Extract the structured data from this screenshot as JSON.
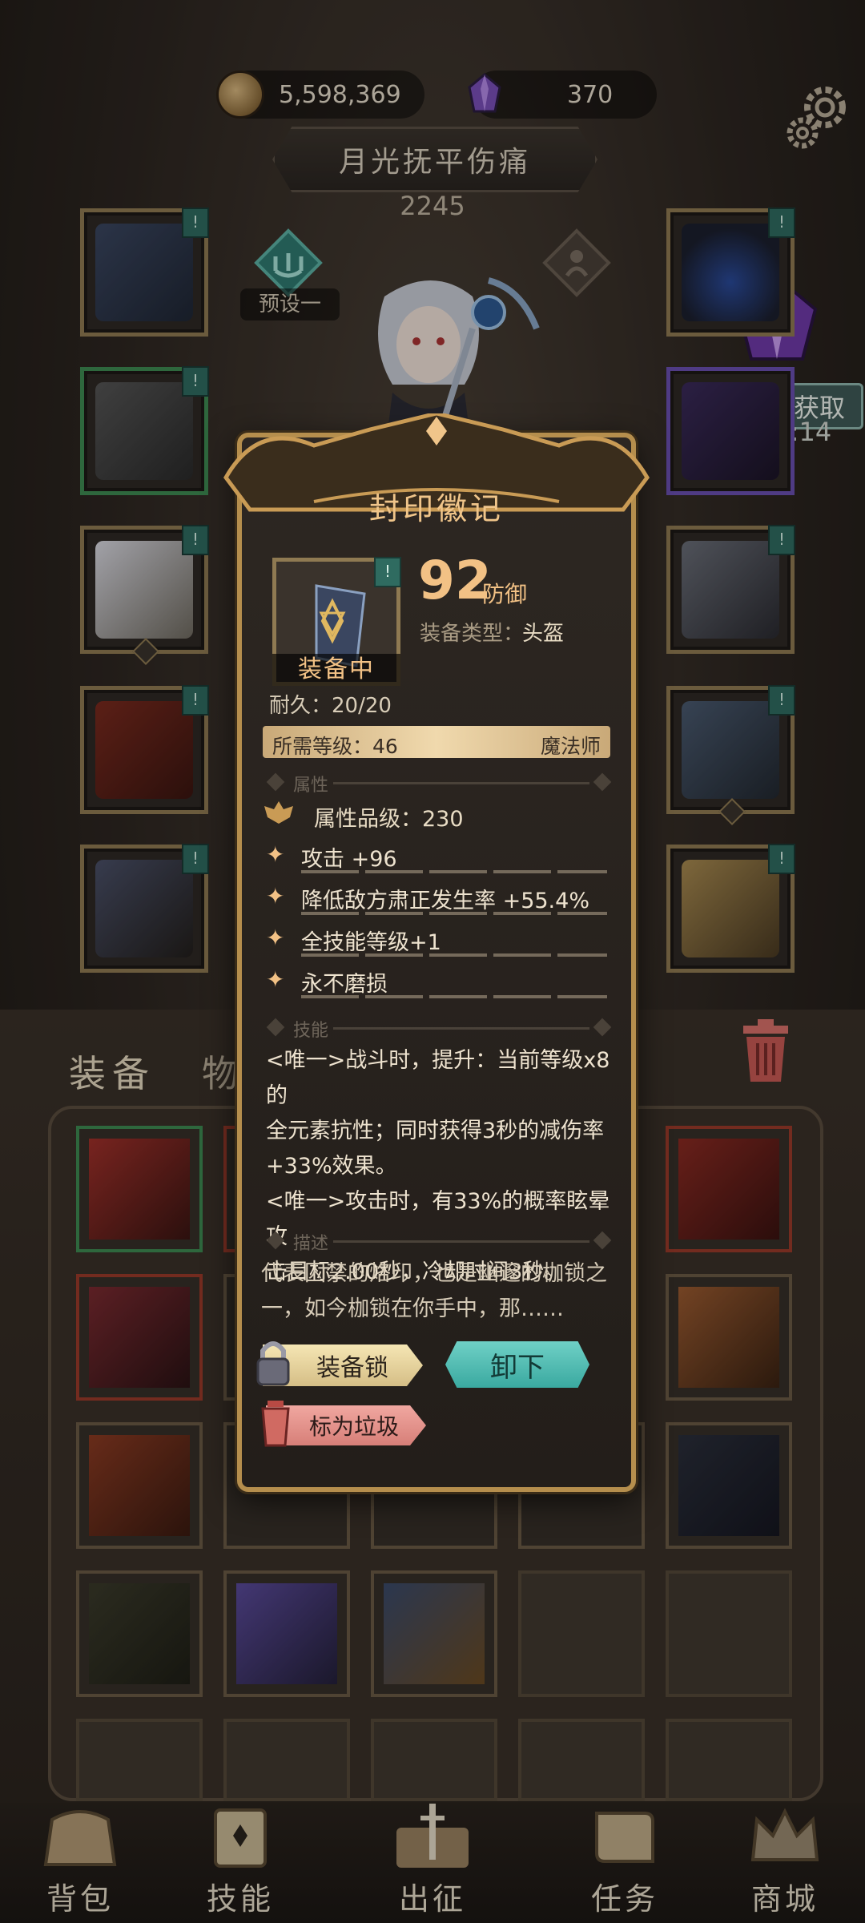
{
  "resources": {
    "gold": {
      "value": "5,598,369",
      "icon": "gold-coin-icon"
    },
    "gems": {
      "value": "370",
      "icon": "purple-crystal-icon"
    }
  },
  "character": {
    "name": "月光抚平伤痛",
    "power": "2245",
    "preset_label": "预设一"
  },
  "video_reward": {
    "label": "视频获取",
    "timer": "00:14"
  },
  "tabs": {
    "equipment": "装备",
    "items": "物品"
  },
  "item_popup": {
    "title": "封印徽记",
    "equipped_label": "装备中",
    "stat_value": "92",
    "stat_unit": "防御",
    "type_label": "装备类型：",
    "type_value": "头盔",
    "durability": "耐久：20/20",
    "required_level": "所需等级：46",
    "class": "魔法师",
    "section_attributes": "属性",
    "attribute_grade": "属性品级：230",
    "attributes": [
      "攻击 +96",
      "降低敌方肃正发生率 +55.4%",
      "全技能等级+1",
      "永不磨损"
    ],
    "section_skills": "技能",
    "skill_lines": [
      "<唯一>战斗时，提升：当前等级x8的",
      "全元素抗性；同时获得3秒的减伤率",
      "+33%效果。",
      "<唯一>攻击时，有33%的概率眩晕攻",
      "击目标2.00秒，冷却时间3秒。"
    ],
    "section_description": "描述",
    "description_lines": [
      "代表囚禁的烙印，也是幽邃的枷锁之",
      "一，如今枷锁在你手中，那……"
    ],
    "lock_button": "装备锁",
    "unequip_button": "卸下",
    "trash_button": "标为垃圾"
  },
  "nav": [
    "背包",
    "技能",
    "出征",
    "任务",
    "商城"
  ],
  "colors": {
    "accent_gold": "#f2c185",
    "frame_gold": "#b58e4d",
    "teal_button": "#3aa9a0",
    "rarity_green": "#3e8a52",
    "rarity_purple": "#6a4fb0",
    "rarity_red": "#9a3a2a"
  }
}
